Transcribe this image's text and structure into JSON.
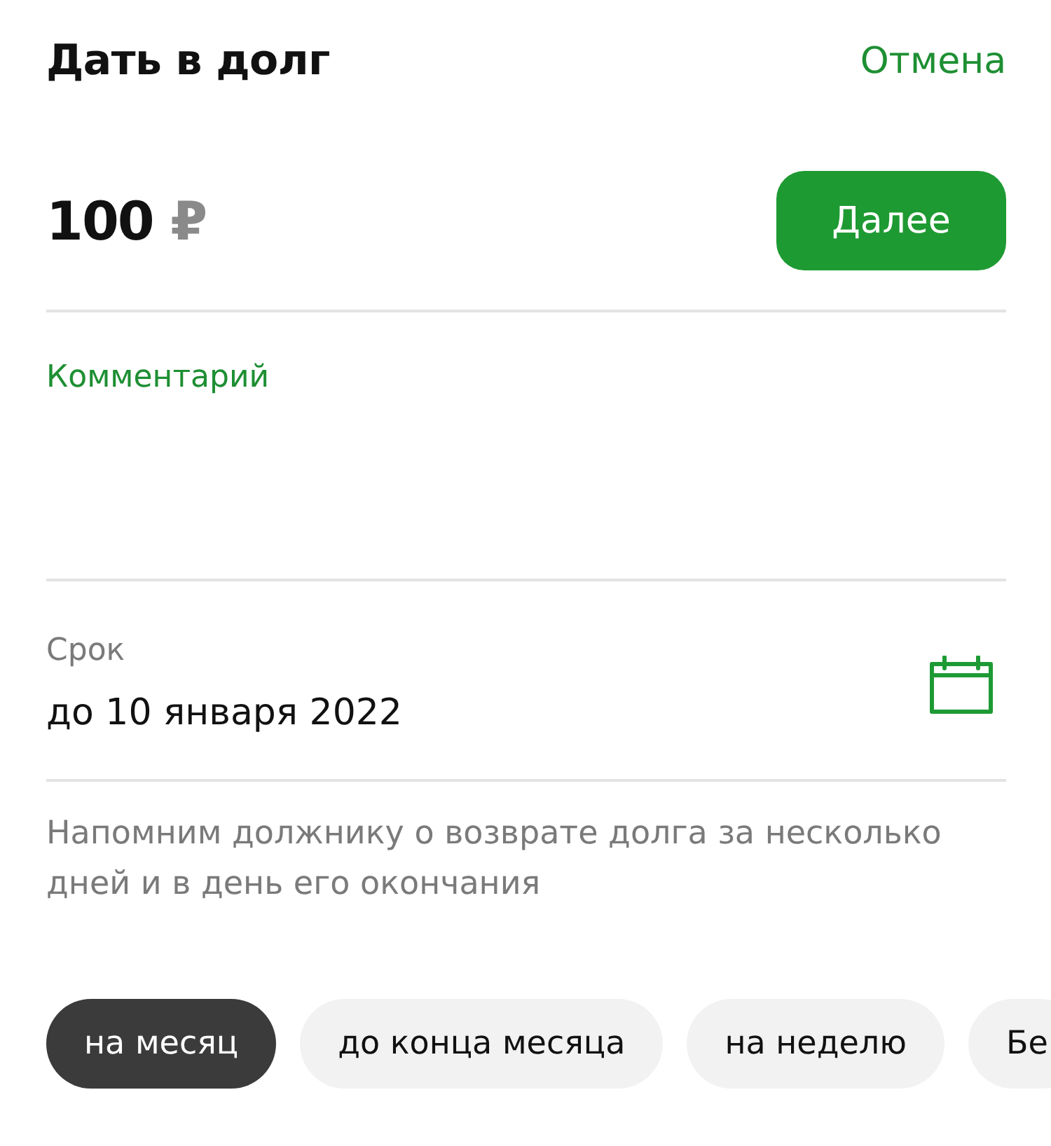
{
  "header": {
    "title": "Дать в долг",
    "cancel": "Отмена"
  },
  "amount": {
    "value": "100",
    "currency": "₽",
    "button": "Далее"
  },
  "comment": {
    "placeholder": "Комментарий"
  },
  "term": {
    "label": "Срок",
    "value": "до 10 января 2022"
  },
  "hint": "Напомним должнику о возврате долга за несколько дней и в день его окончания",
  "chips": [
    {
      "label": "на месяц",
      "selected": true
    },
    {
      "label": "до конца месяца",
      "selected": false
    },
    {
      "label": "на неделю",
      "selected": false
    },
    {
      "label": "Бе",
      "selected": false
    }
  ]
}
